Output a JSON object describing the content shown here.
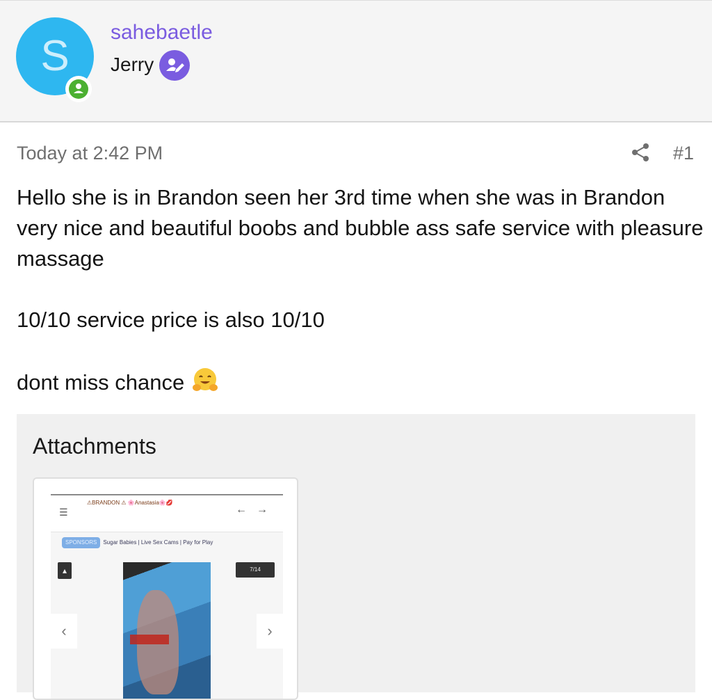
{
  "author": {
    "avatar_letter": "S",
    "username": "sahebaetle",
    "title": "Jerry",
    "status": "online",
    "avatar_color": "#2eb7f0",
    "username_color": "#7a5ce0"
  },
  "post": {
    "timestamp": "Today at 2:42 PM",
    "number": "#1",
    "paragraphs": [
      "Hello she is in Brandon seen her 3rd time when she was in Brandon very nice and beautiful boobs and bubble ass safe service with pleasure massage",
      "10/10 service price is also 10/10",
      "dont miss chance"
    ],
    "emoji": "hugging-face"
  },
  "attachments": {
    "title": "Attachments",
    "thumbnail": {
      "title_line": "⚠BRANDON ⚠ 🌸Anastasia🌸💋",
      "nav_chip": "SPONSORS",
      "nav_links": "Sugar Babies | Live Sex Cams | Pay for Play",
      "photo_count": "7/14"
    }
  },
  "icons": {
    "share": "share-icon",
    "moderator": "pencil-user-icon",
    "online": "user-online-icon"
  }
}
